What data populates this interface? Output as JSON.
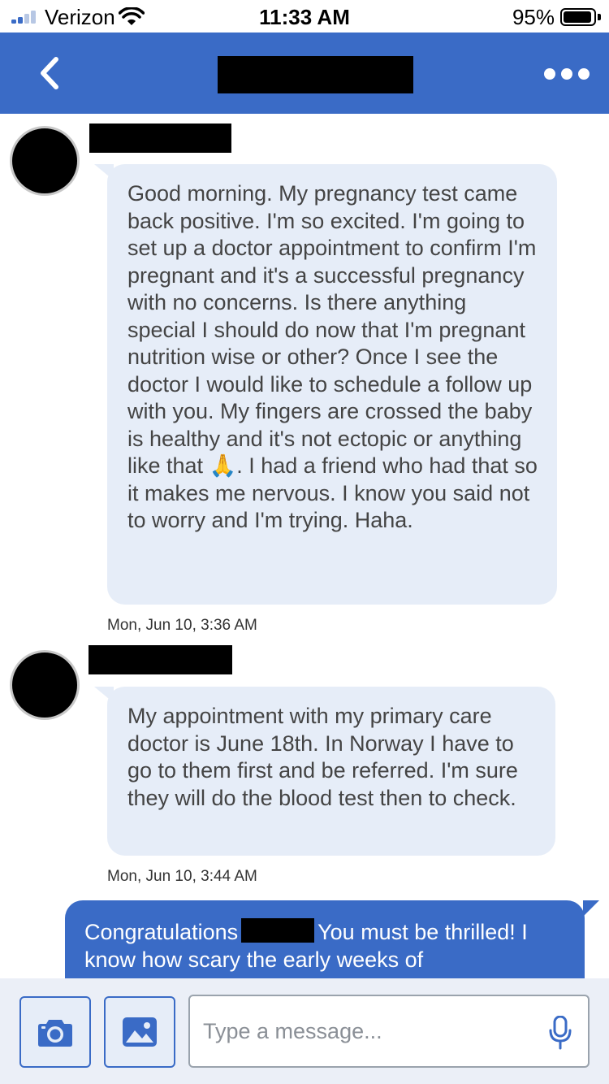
{
  "status_bar": {
    "carrier": "Verizon",
    "time": "11:33 AM",
    "battery": "95%"
  },
  "nav": {
    "back_icon": "chevron-left-icon",
    "more_icon": "ellipsis-icon"
  },
  "messages": [
    {
      "direction": "incoming",
      "text_before_emoji": "Good morning. My pregnancy test came back positive. I'm so excited. I'm going to set up a doctor appointment to confirm I'm pregnant and it's a successful pregnancy with no concerns. Is there anything special I should do now that I'm pregnant nutrition wise or other? Once I see the doctor I would like to schedule a follow up with you. My fingers are crossed the baby is healthy and it's not ectopic or anything like that ",
      "emoji": "🙏",
      "text_after_emoji": ". I had a friend who had that so it makes me nervous. I know you said not to worry and I'm trying. Haha.",
      "timestamp": "Mon, Jun 10, 3:36 AM"
    },
    {
      "direction": "incoming",
      "text": "My appointment with my primary care doctor is June 18th. In Norway I have to go to them first and be referred. I'm sure they will do the blood test then to check.",
      "timestamp": "Mon, Jun 10, 3:44 AM"
    },
    {
      "direction": "outgoing",
      "text_before_redaction": "Congratulations",
      "text_after_redaction": "You must be thrilled! I know how scary the early weeks of"
    }
  ],
  "composer": {
    "placeholder": "Type a message...",
    "camera_icon": "camera-icon",
    "photo_icon": "image-icon",
    "mic_icon": "microphone-icon"
  },
  "colors": {
    "brand_blue": "#3a6bc6",
    "incoming_bubble": "#e6edf8",
    "composer_bg": "#ebeff7"
  }
}
